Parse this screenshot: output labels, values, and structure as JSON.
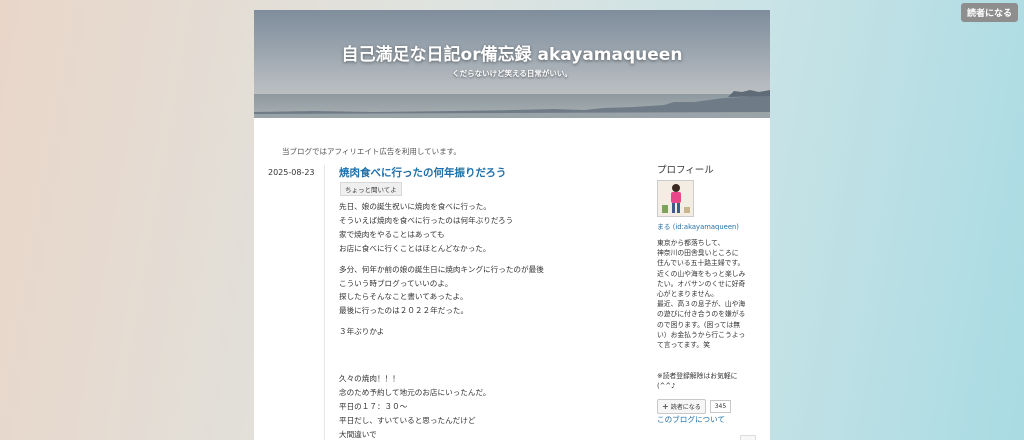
{
  "reader_button": "読者になる",
  "header": {
    "title": "自己満足な日記or備忘録 akayamaqueen",
    "description": "くだらないけど笑える日常がいい。"
  },
  "affiliate_notice": "当ブログではアフィリエイト広告を利用しています。",
  "entry": {
    "date": "2025-08-23",
    "title": "焼肉食べに行ったの何年振りだろう",
    "category": "ちょっと聞いてよ",
    "paragraphs": [
      [
        "先日、娘の誕生祝いに焼肉を食べに行った。",
        "そういえば焼肉を食べに行ったのは何年ぶりだろう",
        "家で焼肉をやることはあっても",
        "お店に食べに行くことはほとんどなかった。"
      ],
      [
        "多分、何年か前の娘の誕生日に焼肉キングに行ったのが最後",
        "こういう時ブログっていいのよ。",
        "探したらそんなこと書いてあったよ。",
        "最後に行ったのは２０２２年だった。"
      ],
      [
        "３年ぶりかよ"
      ],
      [
        "久々の焼肉！！！",
        "念のため予約して地元のお店にいったんだ。",
        "平日の１７：３０～",
        "平日だし、すいていると思ったんだけど",
        "大間違いで"
      ]
    ]
  },
  "sidebar": {
    "heading": "プロフィール",
    "avatar_icon": "profile-avatar-icon",
    "name": "まる (id:akayamaqueen)",
    "profile_lines": [
      "東京から都落ちして、",
      "神奈川の田舎臭いところに",
      "住んでいる五十路主婦です。",
      "近くの山や海をもっと楽しみ",
      "たい。オバサンのくせに好奇",
      "心がとまりません。",
      "最近、高３の息子が、山や海",
      "の遊びに付き合うのを嫌がる",
      "ので困ります。(困っては無",
      "い）お金払うから行こうよっ",
      "て言ってます。笑"
    ],
    "note": "※読者登録解除はお気軽に(^^♪",
    "reader_button": "読者になる",
    "reader_count": "345",
    "about_link": "このブログについて"
  }
}
